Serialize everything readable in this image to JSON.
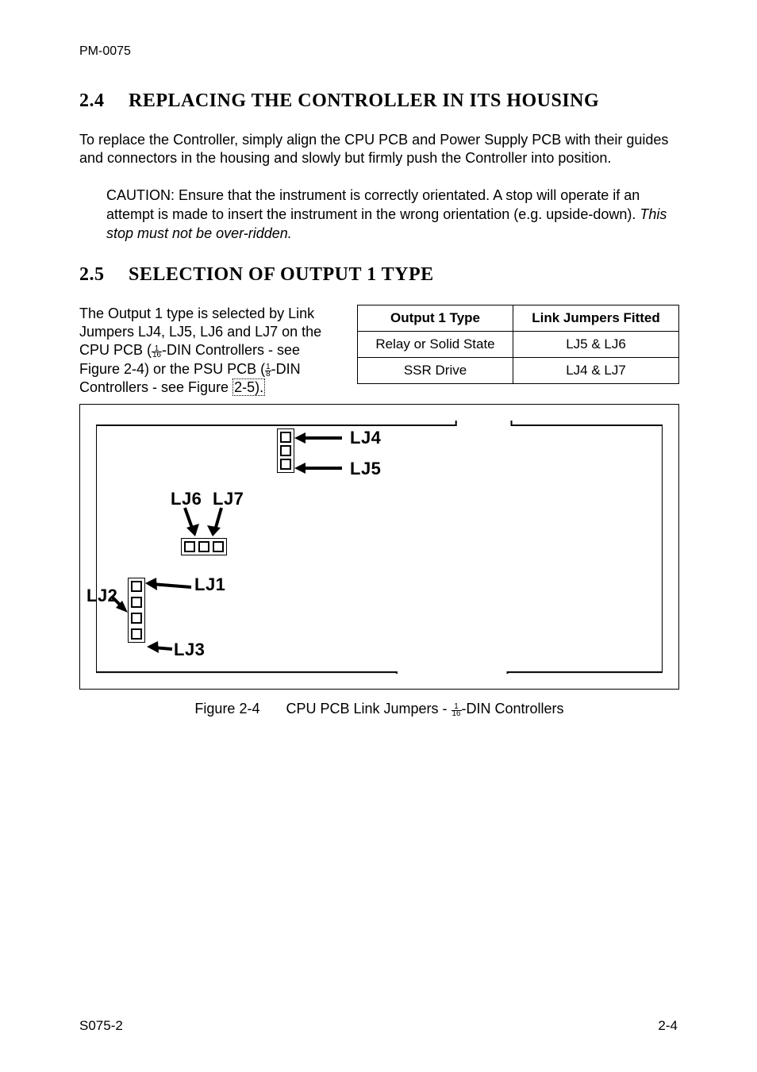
{
  "header": {
    "doc_id": "PM-0075"
  },
  "section24": {
    "number": "2.4",
    "title": "REPLACING THE CONTROLLER IN ITS HOUSING",
    "paragraph": "To replace the Controller, simply align the CPU PCB and Power Supply PCB with their guides and connectors in the housing and slowly but firmly push the Controller into position.",
    "caution_pre": "CAUTION: Ensure that the instrument is correctly orientated. A stop will operate if an attempt is made to insert the instrument in the wrong orientation (e.g. upside-down). ",
    "caution_italic": "This stop must not be over-ridden."
  },
  "section25": {
    "number": "2.5",
    "title": "SELECTION OF OUTPUT 1 TYPE",
    "intro_a": "The Output 1 type is selected by Link Jumpers LJ4, LJ5, LJ6 and LJ7 on the CPU PCB (",
    "intro_b": "-DIN Controllers - see Figure 2-4) or the PSU PCB (",
    "intro_c": "-DIN Controllers - see Figure ",
    "intro_link": "2-5).",
    "table": {
      "head_a": "Output 1 Type",
      "head_b": "Link Jumpers Fitted",
      "rows": [
        {
          "a": "Relay or Solid State",
          "b": "LJ5 & LJ6"
        },
        {
          "a": "SSR Drive",
          "b": "LJ4 & LJ7"
        }
      ]
    }
  },
  "figure": {
    "labels": {
      "lj1": "LJ1",
      "lj2": "LJ2",
      "lj3": "LJ3",
      "lj4": "LJ4",
      "lj5": "LJ5",
      "lj6": "LJ6",
      "lj7": "LJ7"
    },
    "caption_label": "Figure 2-4",
    "caption_a": "CPU PCB Link Jumpers - ",
    "caption_b": "-DIN Controllers"
  },
  "footer": {
    "left": "S075-2",
    "right": "2-4"
  }
}
